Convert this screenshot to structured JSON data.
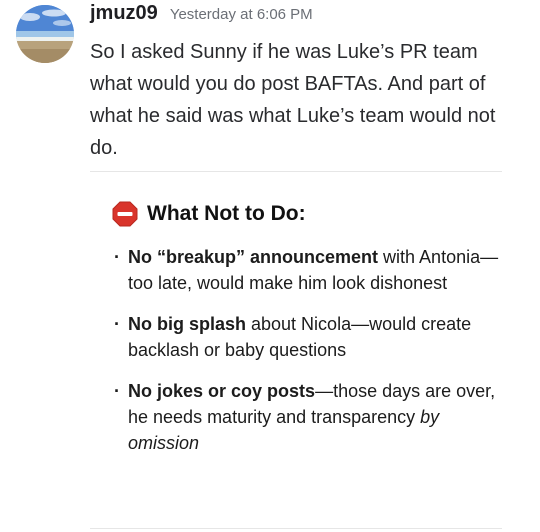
{
  "message": {
    "username": "jmuz09",
    "timestamp": "Yesterday at 6:06 PM",
    "text": "So I asked Sunny if he was Luke’s PR team what would you do post BAFTAs. And part of what he said was what Luke’s team would not do."
  },
  "embed": {
    "heading": "What Not to Do:",
    "icon": "stop-sign-icon",
    "bullets": [
      {
        "bold": "No “breakup” announcement",
        "rest": " with Antonia—too late, would make him look dishonest",
        "italic": ""
      },
      {
        "bold": "No big splash",
        "rest": " about Nicola—would create backlash or baby questions",
        "italic": ""
      },
      {
        "bold": "No jokes or coy posts",
        "rest": "—those days are over, he needs maturity and transparency ",
        "italic": "by omission"
      }
    ]
  },
  "colors": {
    "stop_red": "#d9342b",
    "username": "#1f1f23",
    "timestamp": "#6b6f76",
    "text": "#2a2b2e"
  }
}
